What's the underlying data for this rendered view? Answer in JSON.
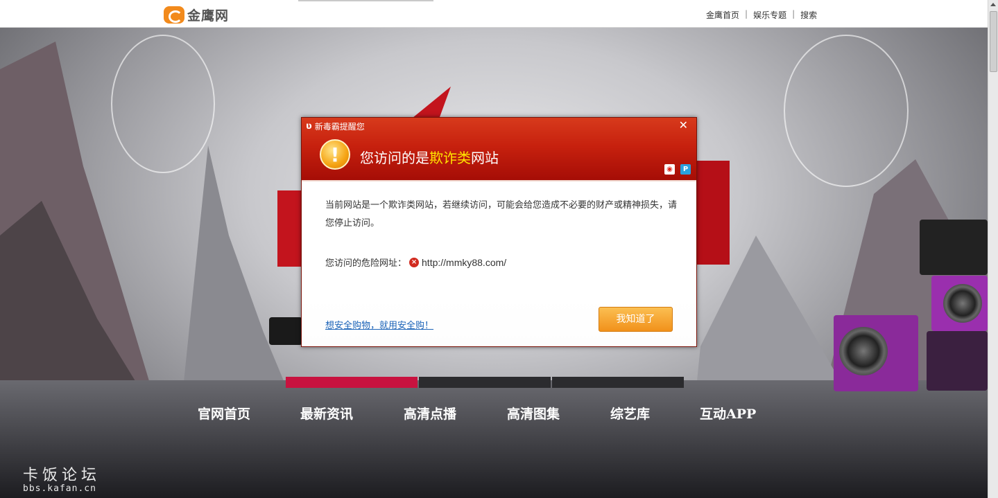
{
  "header": {
    "logo_text": "金鹰网",
    "links": [
      "金鹰首页",
      "娱乐专题",
      "搜索"
    ]
  },
  "nav": {
    "items": [
      "官网首页",
      "最新资讯",
      "高清点播",
      "高清图集",
      "综艺库",
      "互动APP"
    ],
    "active_index": 0
  },
  "watermark": {
    "line1": "卡饭论坛",
    "line2": "bbs.kafan.cn"
  },
  "dialog": {
    "title": "新毒霸提醒您",
    "heading_prefix": "您访问的是",
    "heading_highlight": "欺诈类",
    "heading_suffix": "网站",
    "message": "当前网站是一个欺诈类网站，若继续访问，可能会给您造成不必要的财产或精神损失，请您停止访问。",
    "url_label": "您访问的危险网址：",
    "url": "http://mmky88.com/",
    "link_text": "想安全购物，就用安全购！",
    "ok_label": "我知道了",
    "close_glyph": "✕"
  },
  "colors": {
    "dialog_red": "#c7210e",
    "highlight_yellow": "#ffe400",
    "ok_orange": "#f1911b",
    "tab_active": "#c8123f"
  }
}
